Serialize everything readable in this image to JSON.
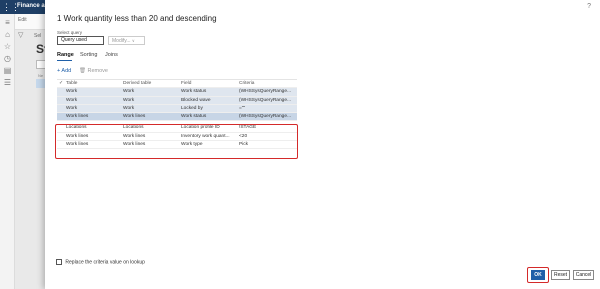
{
  "app": {
    "title": "Finance an",
    "edit_label": "Edit",
    "bg_title": "St",
    "bg_label": "Sel",
    "bg_sub": "Ne",
    "bg_filter": "▽"
  },
  "dialog": {
    "title": "1 Work quantity less than 20 and descending",
    "help": "?",
    "select_query_label": "Select query",
    "select_query_value": "Query used",
    "modify_label": "Modify...",
    "tabs": [
      {
        "label": "Range"
      },
      {
        "label": "Sorting"
      },
      {
        "label": "Joins"
      }
    ],
    "toolbar": {
      "add": "+ Add",
      "remove": "🗑 Remove"
    },
    "grid": {
      "headers": [
        "✓",
        "Table",
        "Derived table",
        "Field",
        "Criteria"
      ],
      "rows": [
        {
          "table": "Work",
          "derived": "Work",
          "field": "Work status",
          "criteria": "(WHSSysQueryRange..."
        },
        {
          "table": "Work",
          "derived": "Work",
          "field": "Blocked wave",
          "criteria": "(WHSSysQueryRange..."
        },
        {
          "table": "Work",
          "derived": "Work",
          "field": "Locked by",
          "criteria": "=\"\""
        },
        {
          "table": "Work lines",
          "derived": "Work lines",
          "field": "Work status",
          "criteria": "(WHSSysQueryRange..."
        },
        {
          "table": "Locations",
          "derived": "Locations",
          "field": "Location profile ID",
          "criteria": "!STAGE"
        },
        {
          "table": "Work lines",
          "derived": "Work lines",
          "field": "Inventory work quant...",
          "criteria": "<20"
        },
        {
          "table": "Work lines",
          "derived": "Work lines",
          "field": "Work type",
          "criteria": "Pick"
        }
      ]
    },
    "footer": {
      "replace_label": "Replace the criteria value on lookup",
      "ok": "OK",
      "reset": "Reset",
      "cancel": "Cancel"
    }
  },
  "colors": {
    "accent": "#1f5fa8",
    "highlight": "#d42a2a",
    "topbar": "#1f3f66"
  }
}
